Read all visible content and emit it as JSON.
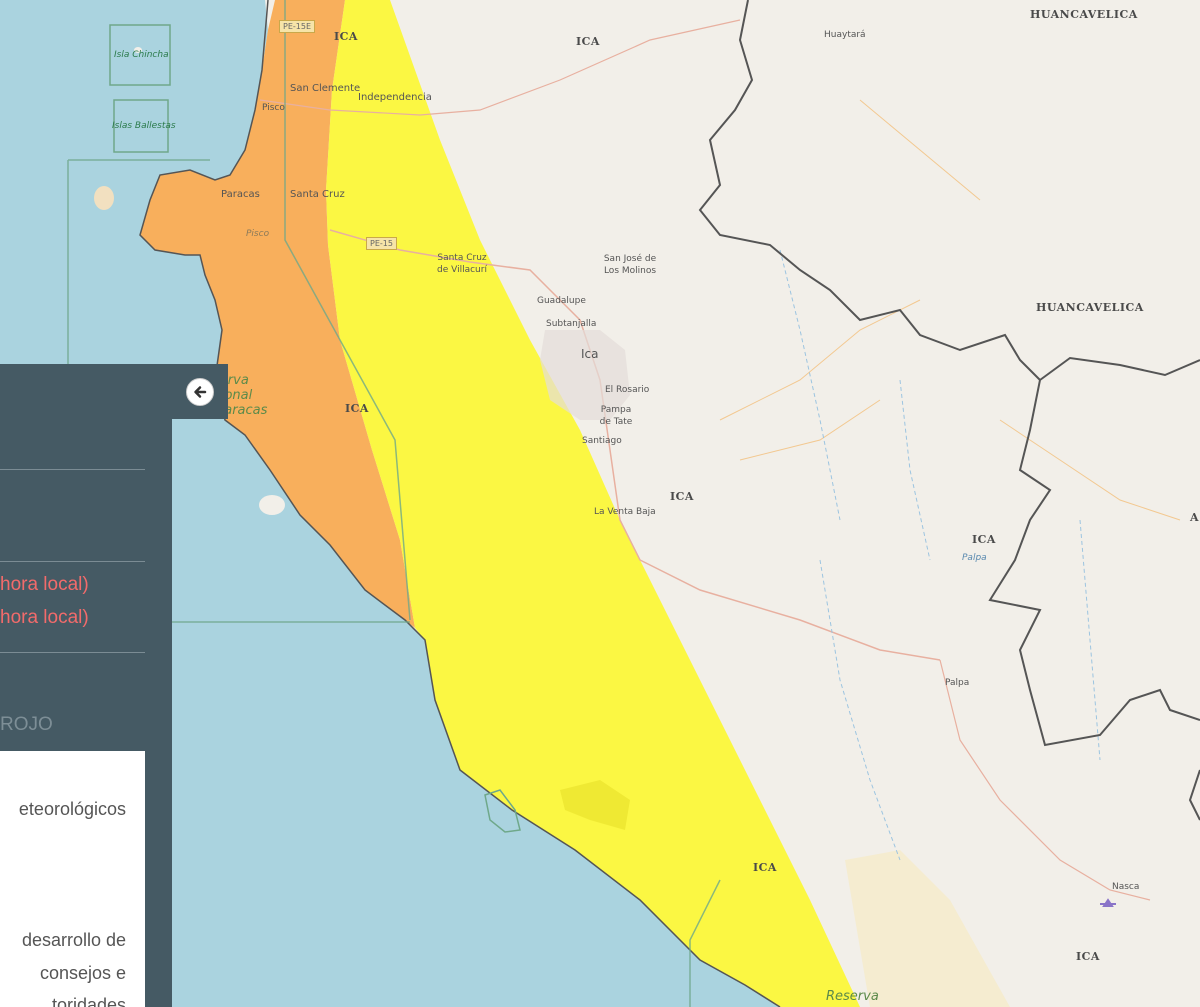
{
  "map": {
    "region_labels": [
      "ICA",
      "ICA",
      "ICA",
      "ICA",
      "ICA",
      "ICA",
      "ICA",
      "HUANCAVELICA",
      "HUANCAVELICA"
    ],
    "place_labels": [
      "San Clemente",
      "Independencia",
      "Huaytará",
      "Paracas",
      "Santa Cruz",
      "Pisco",
      "Santa Cruz de Villacurí",
      "San José de Los Molinos",
      "Guadalupe",
      "Subtanjalla",
      "Ica",
      "El Rosario",
      "Pampa de Tate",
      "Santiago",
      "La Venta Baja",
      "Palpa",
      "Nasca",
      "Pisco",
      "Palpa"
    ],
    "road_labels": [
      "PE-15E",
      "PE-15"
    ],
    "water_labels": [
      "Isla Chincha",
      "Islas Ballestas"
    ],
    "reserve_labels": [
      "Reserva Nacional de Paracas",
      "Reserva"
    ],
    "partial_labels": [
      "A"
    ],
    "alert_colors": {
      "orange": "#f9a94f",
      "yellow": "#fbf73a",
      "red_text": "#f26b6b"
    }
  },
  "panel": {
    "time_line_1": "hora local)",
    "time_line_2": "hora local)",
    "level_label": "ROJO",
    "card_lines": [
      "eteorológicos",
      "desarrollo de",
      "consejos e",
      "toridades"
    ],
    "toggle_icon": "arrow-left-icon"
  }
}
